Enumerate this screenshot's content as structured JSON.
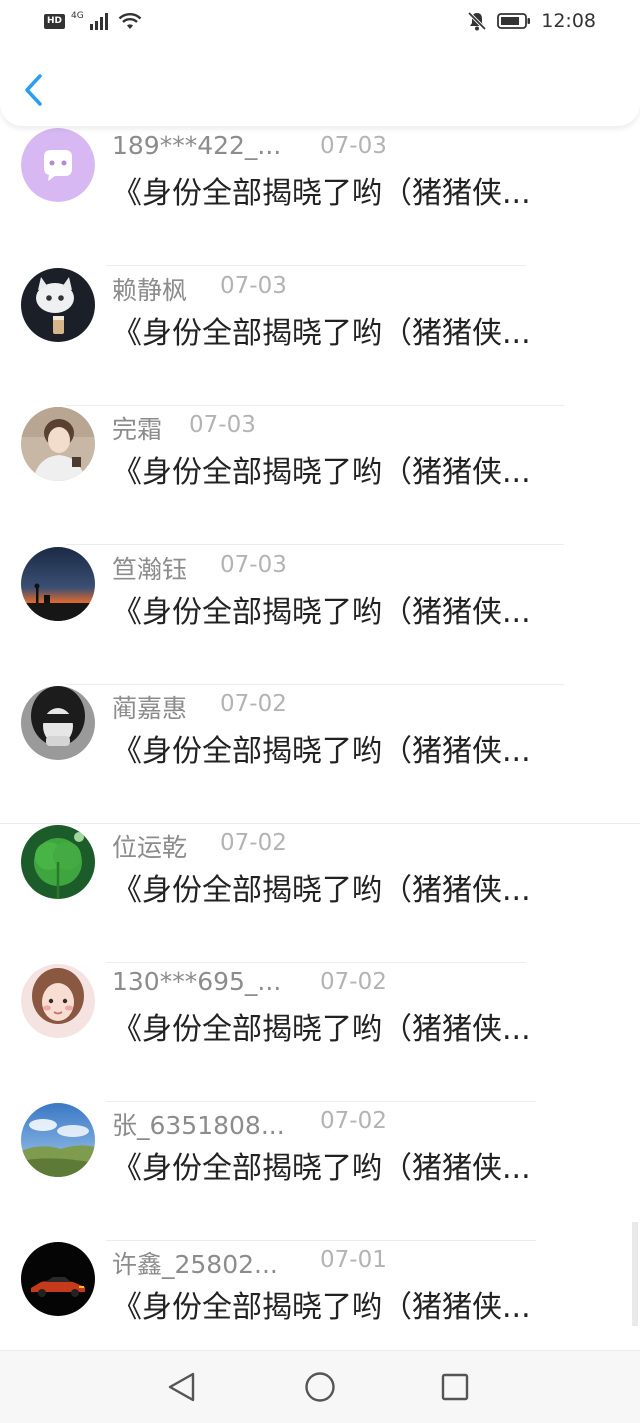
{
  "status_bar": {
    "network_badge": "HD",
    "network_type": "4G",
    "time": "12:08",
    "icons": [
      "signal-icon",
      "wifi-icon",
      "mute-bell-icon",
      "battery-icon"
    ]
  },
  "header": {
    "back_icon": "chevron-left-icon"
  },
  "accent_color": "#2a9df4",
  "comments": [
    {
      "name": "189***422_...",
      "date": "07-03",
      "message": "《身份全部揭晓了哟（猪猪侠...",
      "avatar": "wechat-style-chat-icon"
    },
    {
      "name": "赖静枫",
      "date": "07-03",
      "message": "《身份全部揭晓了哟（猪猪侠...",
      "avatar": "kitten-photo"
    },
    {
      "name": "完霜",
      "date": "07-03",
      "message": "《身份全部揭晓了哟（猪猪侠...",
      "avatar": "portrait-photo"
    },
    {
      "name": "笪瀚钰",
      "date": "07-03",
      "message": "《身份全部揭晓了哟（猪猪侠...",
      "avatar": "sunset-photo"
    },
    {
      "name": "蔺嘉惠",
      "date": "07-02",
      "message": "《身份全部揭晓了哟（猪猪侠...",
      "avatar": "bw-portrait-photo"
    },
    {
      "name": "位运乾",
      "date": "07-02",
      "message": "《身份全部揭晓了哟（猪猪侠...",
      "avatar": "leaf-photo"
    },
    {
      "name": "130***695_...",
      "date": "07-02",
      "message": "《身份全部揭晓了哟（猪猪侠...",
      "avatar": "illustrated-girl-photo"
    },
    {
      "name": "张_6351808...",
      "date": "07-02",
      "message": "《身份全部揭晓了哟（猪猪侠...",
      "avatar": "landscape-photo"
    },
    {
      "name": "许鑫_25802...",
      "date": "07-01",
      "message": "《身份全部揭晓了哟（猪猪侠...",
      "avatar": "sports-car-photo"
    }
  ],
  "nav": {
    "back": "triangle-back-icon",
    "home": "circle-home-icon",
    "recents": "square-recents-icon"
  }
}
